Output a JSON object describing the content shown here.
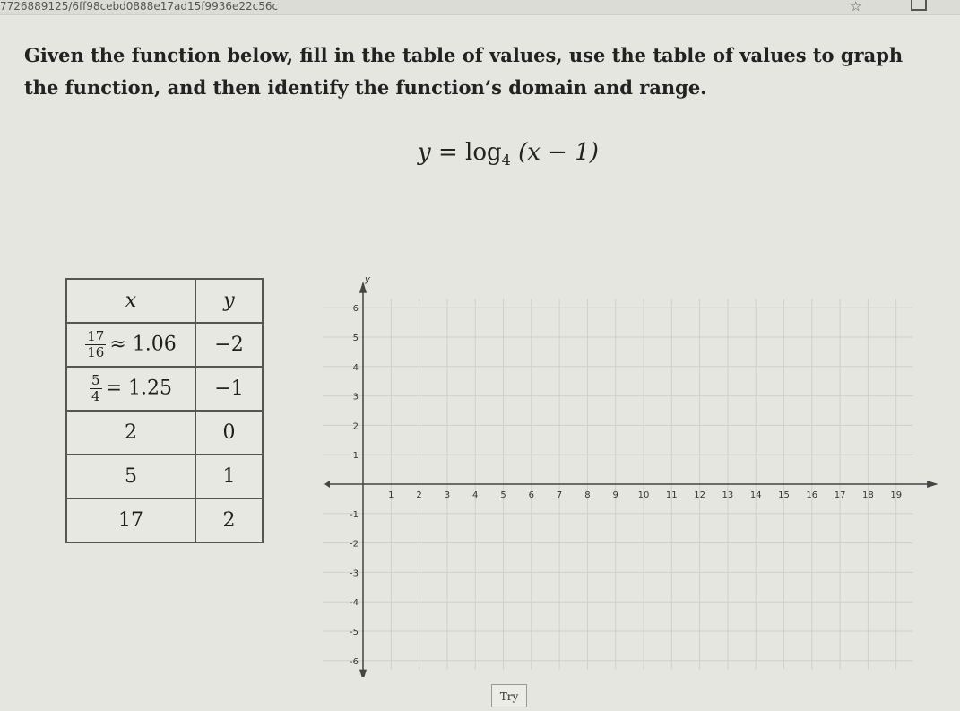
{
  "url_text": "7726889125/6ff98cebd0888e17ad15f9936e22c56c",
  "question": "Given the function below, fill in the table of values, use the table of values to graph the function, and then identify the function’s domain and range.",
  "equation": {
    "lhs": "y",
    "eq": "=",
    "func": "log",
    "base": "4",
    "arg": "(x − 1)"
  },
  "table": {
    "headers": [
      "x",
      "y"
    ],
    "rows": [
      {
        "x_frac": {
          "num": "17",
          "den": "16"
        },
        "x_rest": "≈ 1.06",
        "y": "−2"
      },
      {
        "x_frac": {
          "num": "5",
          "den": "4"
        },
        "x_rest": "= 1.25",
        "y": "−1"
      },
      {
        "x_rest": "2",
        "y": "0"
      },
      {
        "x_rest": "5",
        "y": "1"
      },
      {
        "x_rest": "17",
        "y": "2"
      }
    ]
  },
  "graph": {
    "y_axis_label": "y",
    "x_ticks": [
      "1",
      "2",
      "3",
      "4",
      "5",
      "6",
      "7",
      "8",
      "9",
      "10",
      "11",
      "12",
      "13",
      "14",
      "15",
      "16",
      "17",
      "18",
      "19"
    ],
    "y_ticks_pos": [
      "1",
      "2",
      "3",
      "4",
      "5",
      "6"
    ],
    "y_ticks_neg": [
      "-1",
      "-2",
      "-3",
      "-4",
      "-5",
      "-6"
    ]
  },
  "try_button": "Try"
}
